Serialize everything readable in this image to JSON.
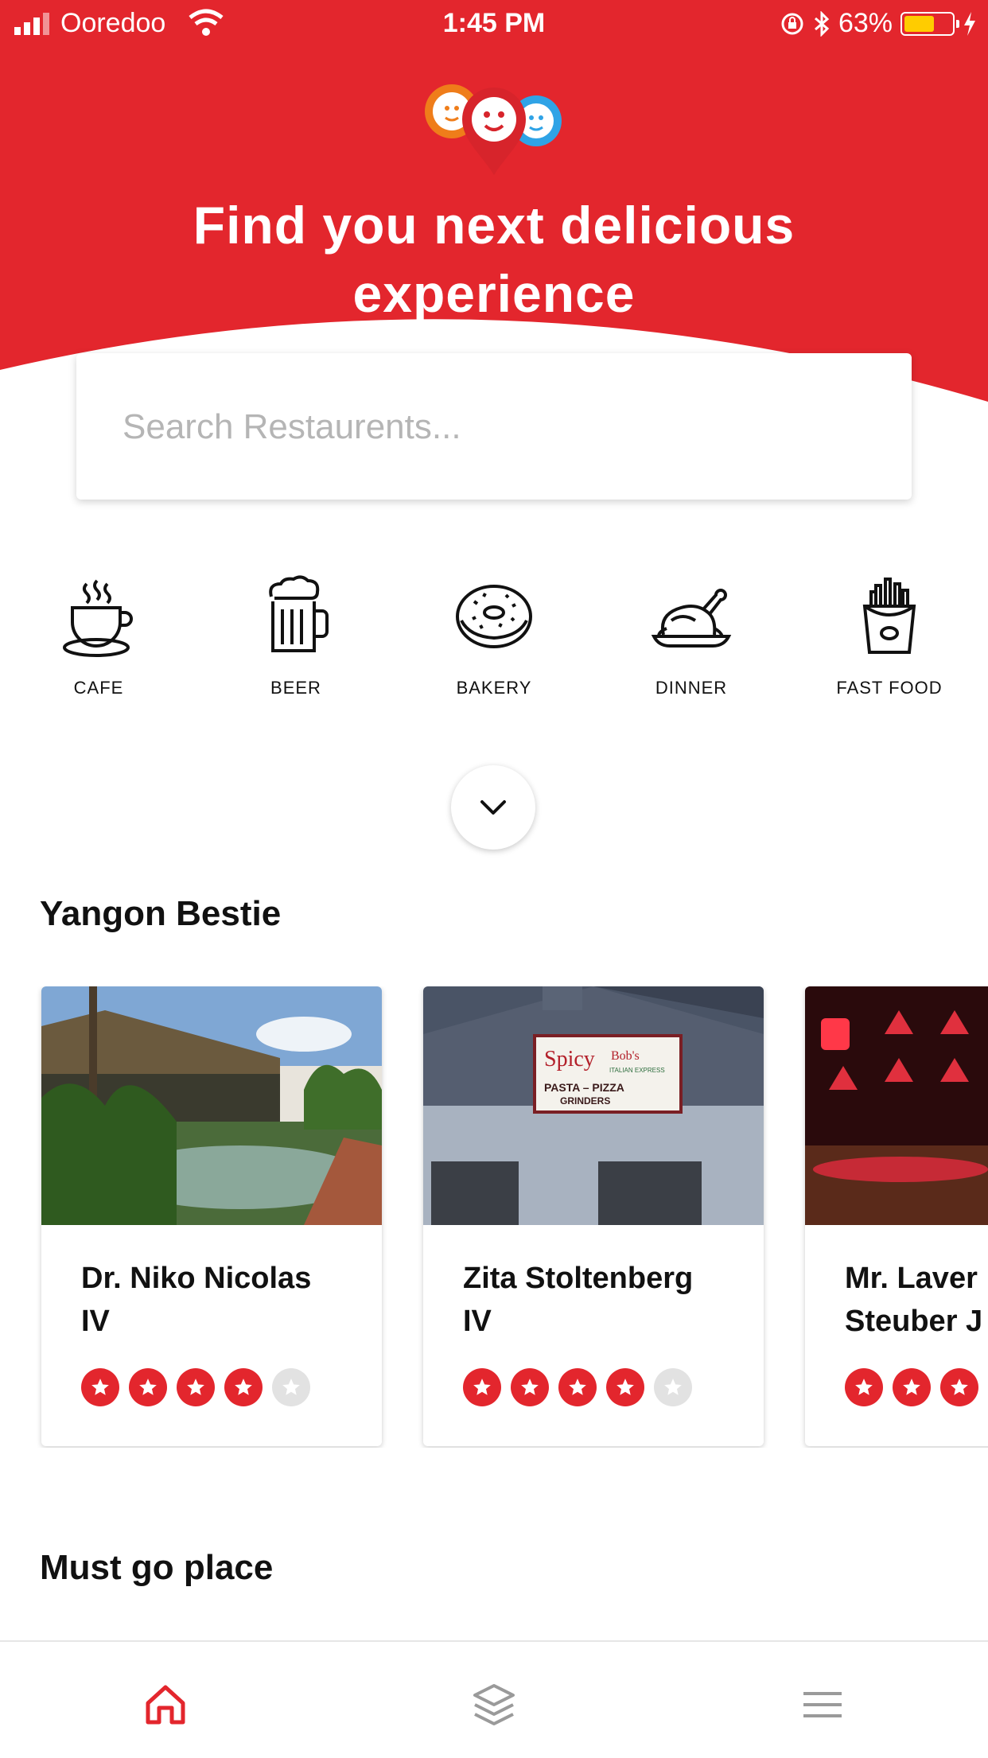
{
  "status_bar": {
    "carrier": "Ooredoo",
    "time": "1:45 PM",
    "battery_percent": "63%",
    "battery_level": 0.63,
    "icons": [
      "signal-icon",
      "wifi-icon",
      "rotation-lock-icon",
      "bluetooth-icon",
      "battery-icon",
      "charging-icon"
    ]
  },
  "colors": {
    "brand_red": "#e3262d",
    "star_off": "#e2e2e2"
  },
  "header": {
    "title": "Find you next delicious experience"
  },
  "search": {
    "placeholder": "Search Restaurents..."
  },
  "categories": [
    {
      "label": "CAFE",
      "icon": "coffee-cup-icon"
    },
    {
      "label": "BEER",
      "icon": "beer-mug-icon"
    },
    {
      "label": "BAKERY",
      "icon": "donut-icon"
    },
    {
      "label": "DINNER",
      "icon": "roast-chicken-icon"
    },
    {
      "label": "FAST FOOD",
      "icon": "fries-icon"
    }
  ],
  "sections": {
    "yangon_bestie": "Yangon Bestie",
    "must_go": "Must go place"
  },
  "restaurants": [
    {
      "name_line1": "Dr. Niko Nicolas",
      "name_line2": "IV",
      "rating": 4,
      "rating_max": 5
    },
    {
      "name_line1": "Zita Stoltenberg",
      "name_line2": "IV",
      "rating": 4,
      "rating_max": 5
    },
    {
      "name_line1": "Mr. Laver",
      "name_line2": "Steuber J",
      "rating": 3,
      "rating_max": 5
    }
  ],
  "sign": {
    "line1": "Spicy",
    "line2": "Bob's",
    "line3": "ITALIAN EXPRESS",
    "line4": "PASTA – PIZZA",
    "line5": "GRINDERS"
  },
  "bottom_nav": [
    {
      "icon": "home-icon",
      "active": true
    },
    {
      "icon": "layers-icon",
      "active": false
    },
    {
      "icon": "menu-icon",
      "active": false
    }
  ]
}
